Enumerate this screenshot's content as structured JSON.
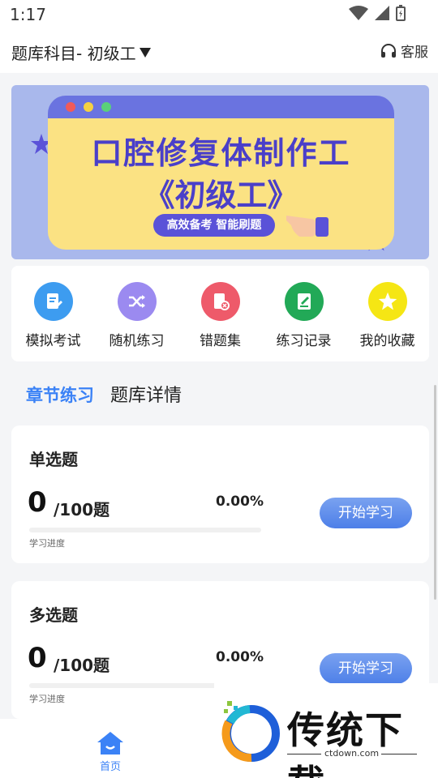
{
  "status_bar": {
    "time": "1:17"
  },
  "header": {
    "subject": "题库科目- 初级工",
    "service_label": "客服"
  },
  "banner": {
    "title": "口腔修复体制作工",
    "subtitle": "《初级工》",
    "tagline": "高效备考 智能刷题"
  },
  "quick_actions": [
    {
      "label": "模拟考试",
      "icon": "exam-icon",
      "color": "#3d9cf0"
    },
    {
      "label": "随机练习",
      "icon": "shuffle-icon",
      "color": "#9b8af0"
    },
    {
      "label": "错题集",
      "icon": "error-book-icon",
      "color": "#ee5a6a"
    },
    {
      "label": "练习记录",
      "icon": "record-icon",
      "color": "#22a957"
    },
    {
      "label": "我的收藏",
      "icon": "star-icon",
      "color": "#f5e614"
    }
  ],
  "tabs": [
    {
      "label": "章节练习",
      "active": true
    },
    {
      "label": "题库详情",
      "active": false
    }
  ],
  "question_types": [
    {
      "title": "单选题",
      "count": "0",
      "total": "/100题",
      "percent": "0.00%",
      "progress": 0,
      "progress_label": "学习进度",
      "button": "开始学习"
    },
    {
      "title": "多选题",
      "count": "0",
      "total": "/100题",
      "percent": "0.00%",
      "progress": 0,
      "progress_label": "学习进度",
      "button": "开始学习"
    }
  ],
  "bottom_nav": {
    "home_label": "首页"
  },
  "watermark": {
    "text": "传统下载",
    "url": "ctdown.com"
  },
  "colors": {
    "accent": "#3b82f6",
    "banner_bg": "#a9b8ec",
    "banner_title": "#4a3fc9"
  }
}
